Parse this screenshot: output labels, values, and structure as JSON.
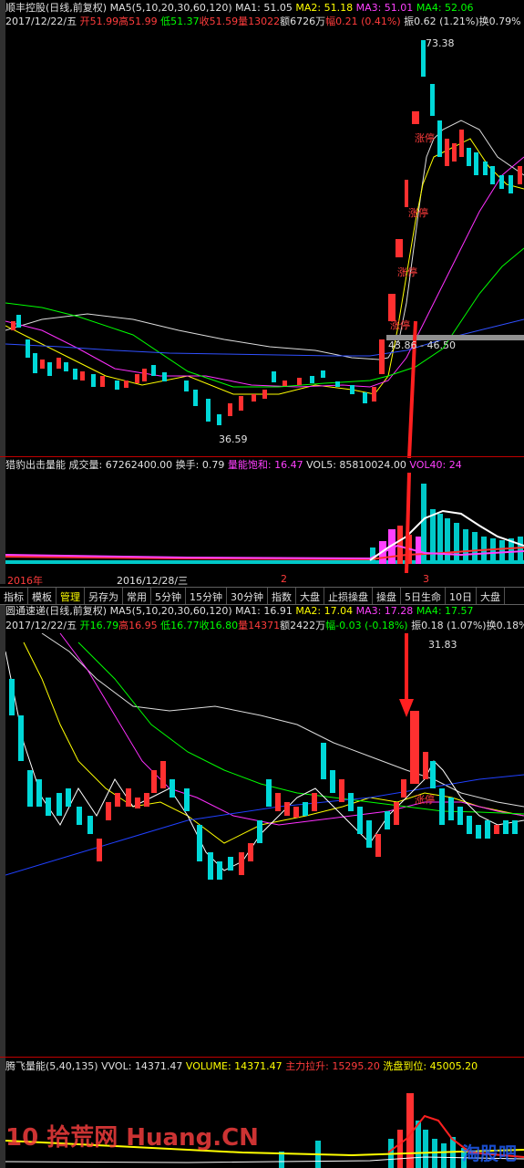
{
  "top": {
    "title": "顺丰控股",
    "period": "(日线,前复权)",
    "ma_label": "MA5(5,10,20,30,60,120)",
    "ma1": "MA1: 51.05",
    "ma2": "MA2: 51.18",
    "ma3": "MA3: 51.01",
    "ma4": "MA4: 52.06",
    "date": "2017/12/22/五",
    "open": "开51.99",
    "high": "高51.99",
    "low": "低51.37",
    "close": "收51.59",
    "vol": "量13022",
    "amount": "额6726万",
    "change": "幅0.21 (0.41%)",
    "amp": "振0.62 (1.21%)",
    "turn": "换0.79%",
    "label_high": "73.38",
    "label_low": "36.59",
    "label_mid": "43.86 - 46.50",
    "zt1": "涨停",
    "zt2": "涨停",
    "zt3": "涨停",
    "zt4": "涨停"
  },
  "vol1": {
    "name": "猎豹出击量能",
    "cjl": "成交量: 67262400.00",
    "hs": "换手: 0.79",
    "lnbh": "量能饱和: 16.47",
    "vol5": "VOL5: 85810024.00",
    "vol40": "VOL40: 24",
    "axis1": "2016年",
    "axis2": "2016/12/28/三",
    "axis3": "2",
    "axis4": "3"
  },
  "toolbar": [
    "指标",
    "模板",
    "管理",
    "另存为",
    "常用",
    "5分钟",
    "15分钟",
    "30分钟",
    "指数",
    "大盘",
    "止损操盘",
    "操盘",
    "5日生命",
    "10日",
    "大盘"
  ],
  "bottom": {
    "title": "圆通速递",
    "period": "(日线,前复权)",
    "ma_label": "MA5(5,10,20,30,60,120)",
    "ma1": "MA1: 16.91",
    "ma2": "MA2: 17.04",
    "ma3": "MA3: 17.28",
    "ma4": "MA4: 17.57",
    "date": "2017/12/22/五",
    "open": "开16.79",
    "high": "高16.95",
    "low": "低16.77",
    "close": "收16.80",
    "vol": "量14371",
    "amount": "额2422万",
    "change": "幅-0.03 (-0.18%)",
    "amp": "振0.18 (1.07%)",
    "turn": "换0.18%",
    "label_high": "31.83",
    "zt": "涨停"
  },
  "vol2": {
    "name": "腾飞量能",
    "params": "(5,40,135)",
    "vvol": "VVOL: 14371.47",
    "volume": "VOLUME: 14371.47",
    "zllt": "主力拉升: 15295.20",
    "xpdw": "洗盘到位: 45005.20"
  },
  "watermark": {
    "left": "10 拾荒网 Huang.CN",
    "right": "淘股吧"
  },
  "chart_data": [
    {
      "type": "candlestick",
      "title": "顺丰控股",
      "annotations": [
        "73.38",
        "36.59",
        "43.86 - 46.50",
        "涨停",
        "涨停",
        "涨停",
        "涨停"
      ],
      "ylim": [
        36.59,
        73.38
      ]
    },
    {
      "type": "bar",
      "title": "猎豹出击量能",
      "annotations": [
        "2016年",
        "2016/12/28/三",
        "2",
        "3"
      ]
    },
    {
      "type": "candlestick",
      "title": "圆通速递",
      "annotations": [
        "31.83",
        "涨停"
      ],
      "ylim_top": 31.83
    },
    {
      "type": "bar",
      "title": "腾飞量能"
    }
  ]
}
